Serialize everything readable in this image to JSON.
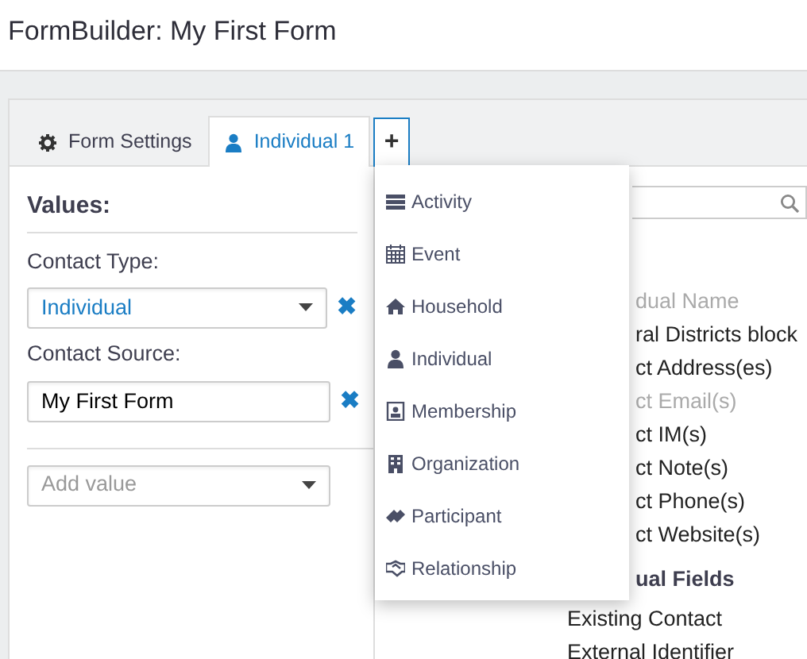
{
  "title": "FormBuilder: My First Form",
  "tabs": [
    {
      "label": "Form Settings",
      "selected": false
    },
    {
      "label": "Individual 1",
      "selected": true
    }
  ],
  "add_tab": {
    "label": "+"
  },
  "values": {
    "heading": "Values:",
    "fields": [
      {
        "kind": "select",
        "label": "Contact Type:",
        "value": "Individual",
        "remove": "✖"
      },
      {
        "kind": "input",
        "label": "Contact Source:",
        "value": "My First Form",
        "remove": "✖"
      }
    ],
    "add": {
      "placeholder": "Add value"
    }
  },
  "menu": [
    {
      "label": "Activity"
    },
    {
      "label": "Event"
    },
    {
      "label": "Household"
    },
    {
      "label": "Individual"
    },
    {
      "label": "Membership"
    },
    {
      "label": "Organization"
    },
    {
      "label": "Participant"
    },
    {
      "label": "Relationship"
    }
  ],
  "fields_panel": [
    {
      "kind": "cut",
      "label": "dual Name",
      "disabled": true
    },
    {
      "kind": "cut",
      "label": "ral Districts block",
      "disabled": false
    },
    {
      "kind": "cut",
      "label": "ct Address(es)",
      "disabled": false
    },
    {
      "kind": "cut",
      "label": "ct Email(s)",
      "disabled": true
    },
    {
      "kind": "cut",
      "label": "ct IM(s)",
      "disabled": false
    },
    {
      "kind": "cut",
      "label": "ct Note(s)",
      "disabled": false
    },
    {
      "kind": "cut",
      "label": "ct Phone(s)",
      "disabled": false
    },
    {
      "kind": "cut",
      "label": "ct Website(s)",
      "disabled": false
    },
    {
      "kind": "cut-heading",
      "label": "ual Fields"
    },
    {
      "kind": "item",
      "label": "Existing Contact",
      "disabled": false
    },
    {
      "kind": "item",
      "label": "External Identifier",
      "disabled": false
    }
  ]
}
